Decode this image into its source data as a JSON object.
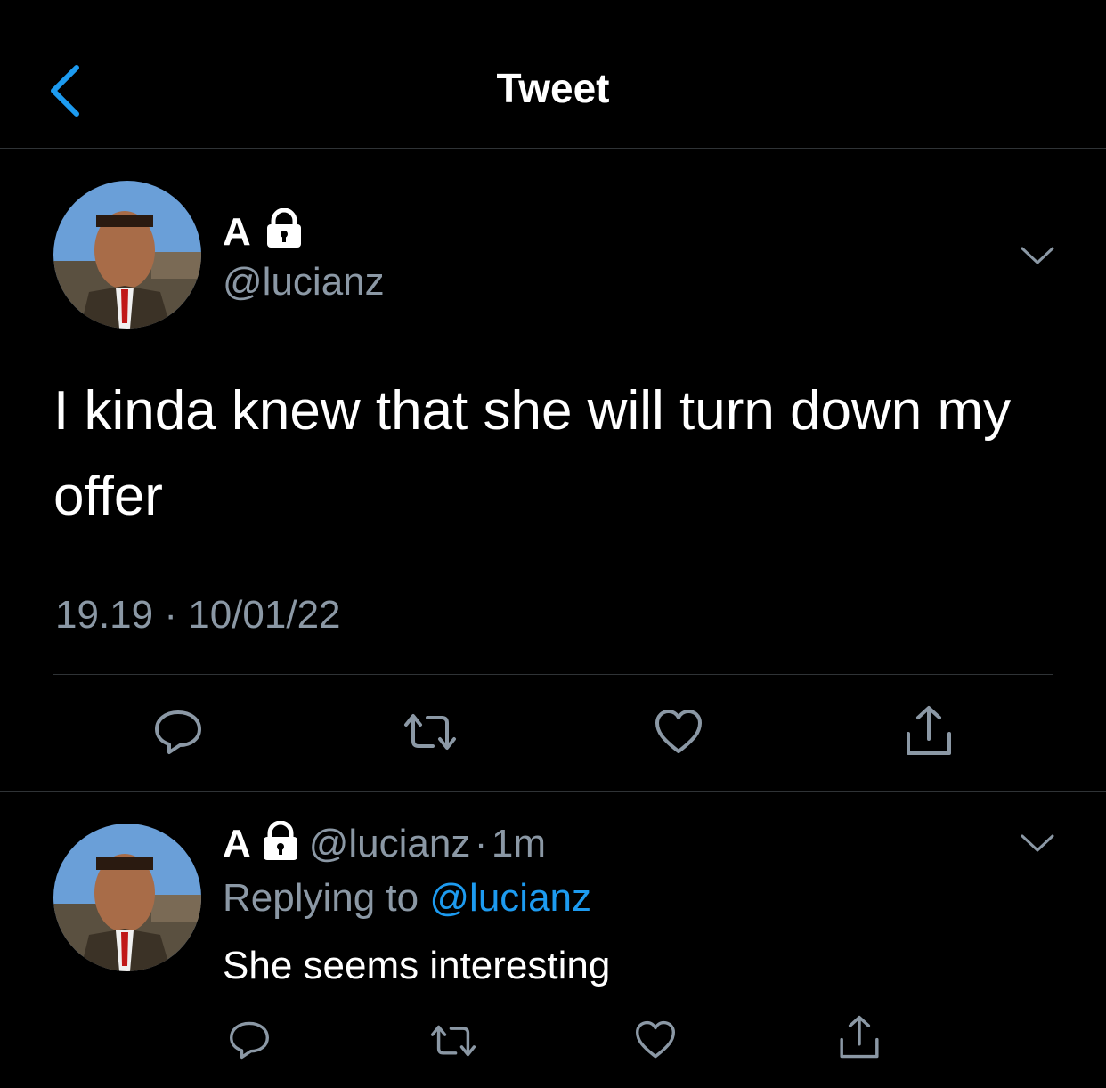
{
  "nav": {
    "title": "Tweet",
    "back_icon": "chevron-left-icon"
  },
  "main_tweet": {
    "display_name": "A",
    "lock_icon": "lock-icon",
    "handle": "@lucianz",
    "text": "I kinda knew that she will turn down my offer",
    "time": "19.19",
    "separator": "·",
    "date": "10/01/22",
    "actions": [
      "reply-icon",
      "retweet-icon",
      "like-icon",
      "share-icon"
    ]
  },
  "reply_tweet": {
    "display_name": "A",
    "handle": "@lucianz",
    "separator": "·",
    "age": "1m",
    "replying_to_label": "Replying to",
    "replying_to_handle": "@lucianz",
    "text": "She seems interesting",
    "actions": [
      "reply-icon",
      "retweet-icon",
      "like-icon",
      "share-icon"
    ]
  },
  "colors": {
    "accent": "#1d9bf0",
    "secondary_text": "#8b98a5",
    "divider": "#2f3336",
    "background": "#000000"
  }
}
